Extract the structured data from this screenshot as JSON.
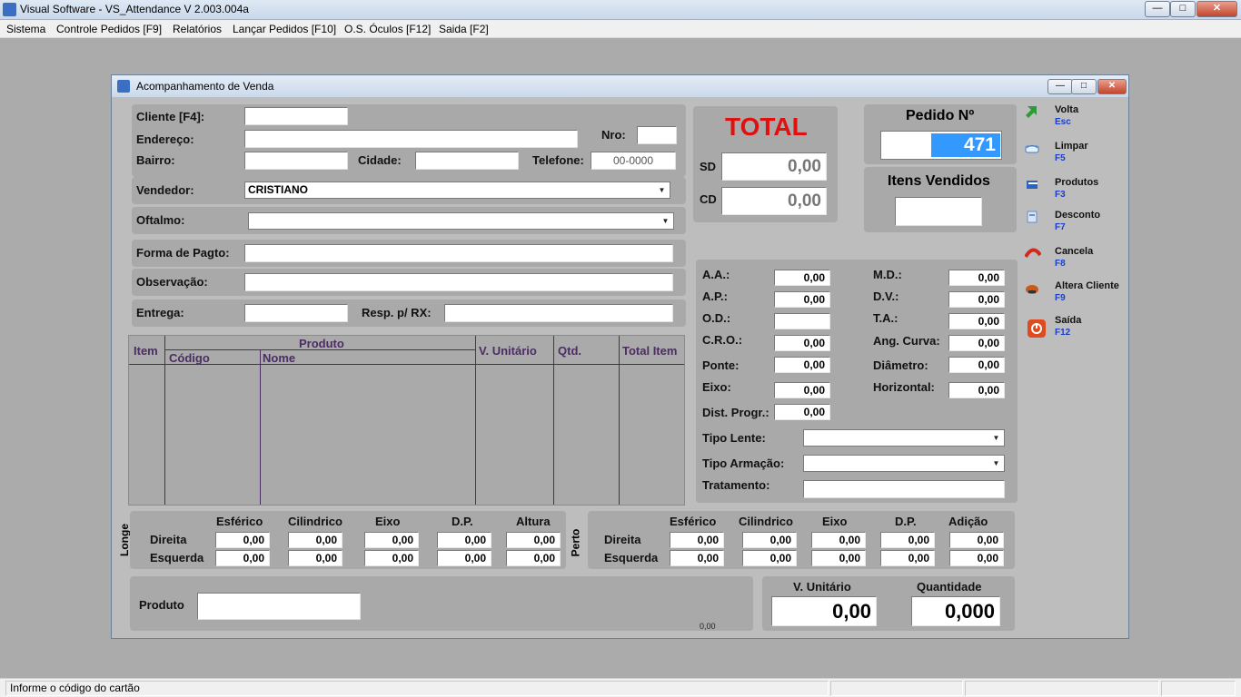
{
  "window": {
    "title": "Visual Software  - VS_Attendance V 2.003.004a",
    "min": "—",
    "max": "□",
    "close": "✕"
  },
  "menu": [
    "Sistema",
    "Controle Pedidos [F9]",
    "Relatórios",
    "Lançar Pedidos [F10]",
    "O.S. Óculos [F12]",
    "Saida [F2]"
  ],
  "dialog": {
    "title": "Acompanhamento de Venda"
  },
  "form": {
    "cliente": "Cliente [F4]:",
    "endereco": "Endereço:",
    "nro": "Nro:",
    "bairro": "Bairro:",
    "cidade": "Cidade:",
    "telefone": "Telefone:",
    "telefone_placeholder": "00-0000",
    "vendedor": "Vendedor:",
    "vendedor_value": "CRISTIANO",
    "oftalmo": "Oftalmo:",
    "forma_pagto": "Forma de Pagto:",
    "observacao": "Observação:",
    "entrega": "Entrega:",
    "resp_rx": "Resp. p/ RX:"
  },
  "total": {
    "title": "TOTAL",
    "sd_label": "SD",
    "sd_value": "0,00",
    "cd_label": "CD",
    "cd_value": "0,00"
  },
  "pedido": {
    "label": "Pedido Nº",
    "value": "471",
    "itens_label": "Itens Vendidos"
  },
  "table": {
    "item": "Item",
    "produto": "Produto",
    "codigo": "Código",
    "nome": "Nome",
    "v_unitario": "V. Unitário",
    "qtd": "Qtd.",
    "total_item": "Total Item"
  },
  "measures": {
    "aa": "A.A.:",
    "aa_v": "0,00",
    "ap": "A.P.:",
    "ap_v": "0,00",
    "od": "O.D.:",
    "cro": "C.R.O.:",
    "cro_v": "0,00",
    "ponte": "Ponte:",
    "ponte_v": "0,00",
    "eixo": "Eixo:",
    "eixo_v": "0,00",
    "dist": "Dist. Progr.:",
    "dist_v": "0,00",
    "md": "M.D.:",
    "md_v": "0,00",
    "dv": "D.V.:",
    "dv_v": "0,00",
    "ta": "T.A.:",
    "ta_v": "0,00",
    "ang": "Ang. Curva:",
    "ang_v": "0,00",
    "diam": "Diâmetro:",
    "diam_v": "0,00",
    "horiz": "Horizontal:",
    "horiz_v": "0,00",
    "tipo_lente": "Tipo Lente:",
    "tipo_armacao": "Tipo Armação:",
    "tratamento": "Tratamento:"
  },
  "longe": {
    "side": "Longe",
    "cols": [
      "Esférico",
      "Cilindrico",
      "Eixo",
      "D.P.",
      "Altura"
    ],
    "rows": [
      {
        "label": "Direita",
        "values": [
          "0,00",
          "0,00",
          "0,00",
          "0,00",
          "0,00"
        ]
      },
      {
        "label": "Esquerda",
        "values": [
          "0,00",
          "0,00",
          "0,00",
          "0,00",
          "0,00"
        ]
      }
    ]
  },
  "perto": {
    "side": "Perto",
    "cols": [
      "Esférico",
      "Cilindrico",
      "Eixo",
      "D.P.",
      "Adição"
    ],
    "rows": [
      {
        "label": "Direita",
        "values": [
          "0,00",
          "0,00",
          "0,00",
          "0,00",
          "0,00"
        ]
      },
      {
        "label": "Esquerda",
        "values": [
          "0,00",
          "0,00",
          "0,00",
          "0,00",
          "0,00"
        ]
      }
    ]
  },
  "bottom": {
    "produto": "Produto",
    "small_value": "0,00",
    "v_unitario_label": "V. Unitário",
    "v_unitario": "0,00",
    "quantidade_label": "Quantidade",
    "quantidade": "0,000"
  },
  "sidebar": [
    {
      "label": "Volta",
      "key": "Esc",
      "icon": "back-arrow-icon",
      "color": "#2e9b3a"
    },
    {
      "label": "Limpar",
      "key": "F5",
      "icon": "eraser-icon",
      "color": "#3a7cc8"
    },
    {
      "label": "Produtos",
      "key": "F3",
      "icon": "products-icon",
      "color": "#2b63c4"
    },
    {
      "label": "Desconto",
      "key": "F7",
      "icon": "discount-icon",
      "color": "#6a8ccc"
    },
    {
      "label": "Cancela",
      "key": "F8",
      "icon": "cancel-icon",
      "color": "#d02a1c"
    },
    {
      "label": "Altera Cliente",
      "key": "F9",
      "icon": "edit-client-icon",
      "color": "#c85a1a"
    },
    {
      "label": "Saída",
      "key": "F12",
      "icon": "exit-icon",
      "color": "#e04a1f"
    }
  ],
  "status": {
    "text": "Informe o código do cartão"
  }
}
